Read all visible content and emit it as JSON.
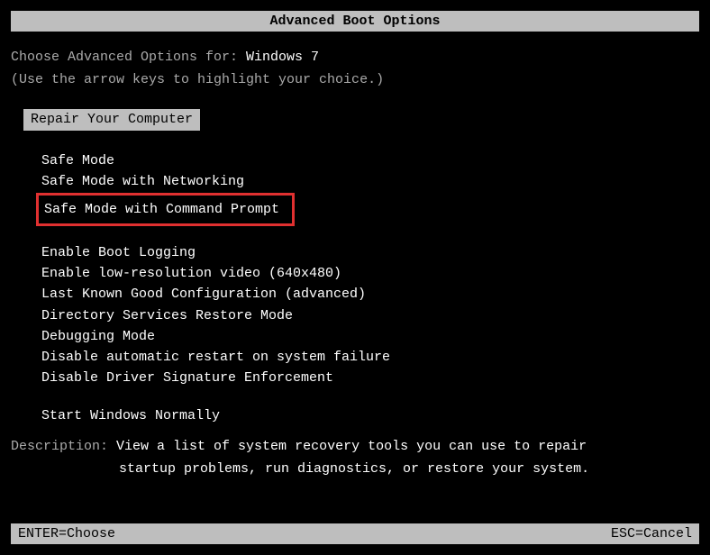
{
  "title": "Advanced Boot Options",
  "prompt_label": "Choose Advanced Options for: ",
  "os_name": "Windows 7",
  "hint": "(Use the arrow keys to highlight your choice.)",
  "selected_option": "Repair Your Computer",
  "group1": [
    "Safe Mode",
    "Safe Mode with Networking"
  ],
  "highlighted_option": "Safe Mode with Command Prompt",
  "group2": [
    "Enable Boot Logging",
    "Enable low-resolution video (640x480)",
    "Last Known Good Configuration (advanced)",
    "Directory Services Restore Mode",
    "Debugging Mode",
    "Disable automatic restart on system failure",
    "Disable Driver Signature Enforcement"
  ],
  "group3": [
    "Start Windows Normally"
  ],
  "description_label": "Description: ",
  "description_text1": "View a list of system recovery tools you can use to repair",
  "description_text2": "startup problems, run diagnostics, or restore your system.",
  "footer_left": "ENTER=Choose",
  "footer_right": "ESC=Cancel"
}
